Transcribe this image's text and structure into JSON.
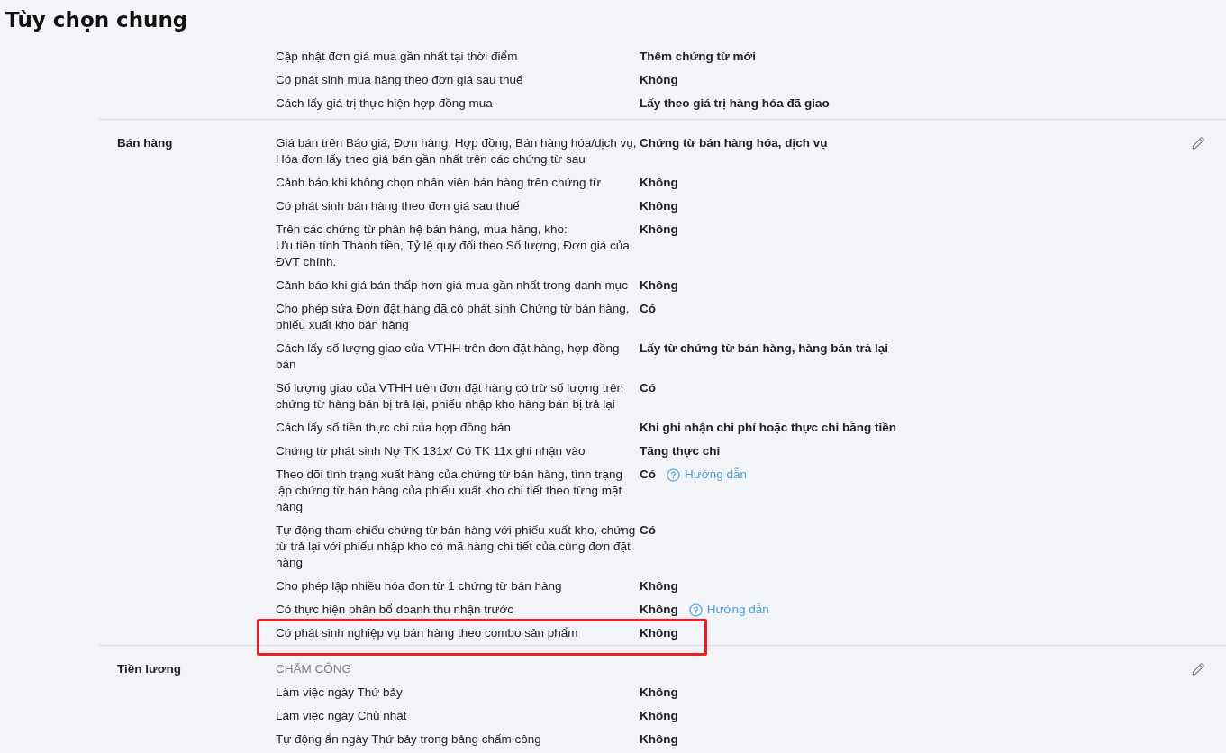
{
  "page_title": "Tùy chọn chung",
  "sections": [
    {
      "rows": [
        {
          "kind": "option",
          "label": "Cập nhật đơn giá mua gần nhất tại thời điểm",
          "value": "Thêm chứng từ mới"
        },
        {
          "kind": "option",
          "label": "Có phát sinh mua hàng theo đơn giá sau thuế",
          "value": "Không"
        },
        {
          "kind": "option",
          "label": "Cách lấy giá trị thực hiện hợp đồng mua",
          "value": "Lấy theo giá trị hàng hóa đã giao"
        }
      ]
    },
    {
      "label": "Bán hàng",
      "editable": true,
      "rows": [
        {
          "kind": "option",
          "label": "Giá bán trên Báo giá, Đơn hàng, Hợp đồng, Bán hàng hóa/dịch vụ, Hóa đơn lấy theo giá bán gần nhất trên các chứng từ sau",
          "value": "Chứng từ bán hàng hóa, dịch vụ"
        },
        {
          "kind": "option",
          "label": "Cảnh báo khi không chọn nhân viên bán hàng trên chứng từ",
          "value": "Không"
        },
        {
          "kind": "option",
          "label": "Có phát sinh bán hàng theo đơn giá sau thuế",
          "value": "Không"
        },
        {
          "kind": "option",
          "label": "Trên các chứng từ phân hệ bán hàng, mua hàng, kho:\nƯu tiên tính Thành tiền, Tỷ lệ quy đổi theo Số lượng, Đơn giá của ĐVT chính.",
          "value": "Không"
        },
        {
          "kind": "option",
          "label": "Cảnh báo khi giá bán thấp hơn giá mua gần nhất trong danh mục",
          "value": "Không"
        },
        {
          "kind": "option",
          "label": "Cho phép sửa Đơn đặt hàng đã có phát sinh Chứng từ bán hàng, phiếu xuất kho bán hàng",
          "value": "Có"
        },
        {
          "kind": "option",
          "label": "Cách lấy số lượng giao của VTHH trên đơn đặt hàng, hợp đồng bán",
          "value": "Lấy từ chứng từ bán hàng, hàng bán trả lại"
        },
        {
          "kind": "option",
          "label": "Số lượng giao của VTHH trên đơn đặt hàng có trừ số lượng trên chứng từ hàng bán bị trả lại, phiếu nhập kho hàng bán bị trả lại",
          "value": "Có"
        },
        {
          "kind": "option",
          "label": "Cách lấy số tiền thực chi của hợp đồng bán",
          "value": "Khi ghi nhận chi phí hoặc thực chi bằng tiền"
        },
        {
          "kind": "option",
          "label": "Chứng từ phát sinh Nợ TK 131x/ Có TK 11x ghi nhận vào",
          "value": "Tăng thực chi"
        },
        {
          "kind": "option",
          "label": "Theo dõi tình trạng xuất hàng của chứng từ bán hàng, tình trạng lập chứng từ bán hàng của phiếu xuất kho chi tiết theo từng mặt hàng",
          "value": "Có",
          "help": "Hướng dẫn"
        },
        {
          "kind": "option",
          "label": "Tự động tham chiếu chứng từ bán hàng với phiếu xuất kho, chứng từ trả lại với phiếu nhập kho có mã hàng chi tiết của cùng đơn đặt hàng",
          "value": "Có"
        },
        {
          "kind": "option",
          "label": "Cho phép lập nhiều hóa đơn từ 1 chứng từ bán hàng",
          "value": "Không"
        },
        {
          "kind": "option",
          "label": "Có thực hiện phân bổ doanh thu nhận trước",
          "value": "Không",
          "help": "Hướng dẫn"
        },
        {
          "kind": "option",
          "label": "Có phát sinh nghiệp vụ bán hàng theo combo sản phẩm",
          "value": "Không",
          "highlighted": true
        }
      ]
    },
    {
      "label": "Tiền lương",
      "editable": true,
      "rows": [
        {
          "kind": "heading",
          "label": "CHẤM CÔNG"
        },
        {
          "kind": "option",
          "label": "Làm việc ngày Thứ bảy",
          "value": "Không"
        },
        {
          "kind": "option",
          "label": "Làm việc ngày Chủ nhật",
          "value": "Không"
        },
        {
          "kind": "option",
          "label": "Tự động ẩn ngày Thứ bảy trong bảng chấm công",
          "value": "Không"
        }
      ]
    }
  ]
}
